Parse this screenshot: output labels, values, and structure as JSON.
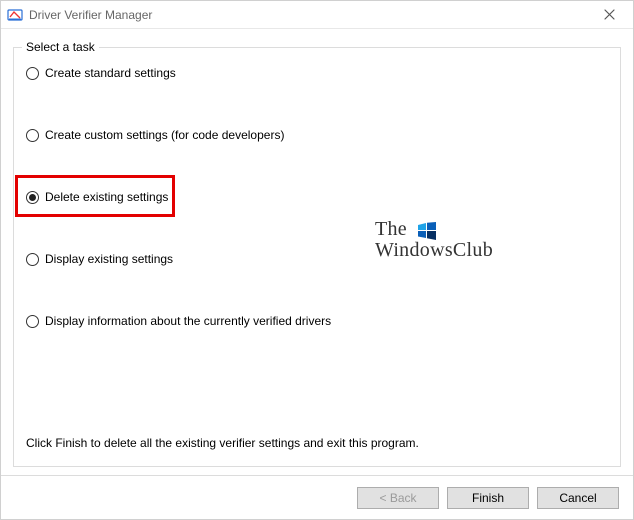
{
  "window": {
    "title": "Driver Verifier Manager"
  },
  "group": {
    "title": "Select a task"
  },
  "options": [
    {
      "label": "Create standard settings",
      "selected": false
    },
    {
      "label": "Create custom settings (for code developers)",
      "selected": false
    },
    {
      "label": "Delete existing settings",
      "selected": true,
      "highlighted": true
    },
    {
      "label": "Display existing settings",
      "selected": false
    },
    {
      "label": "Display information about the currently verified drivers",
      "selected": false
    }
  ],
  "info_text": "Click Finish to delete all the existing verifier settings and exit this program.",
  "footer": {
    "back": "< Back",
    "back_enabled": false,
    "finish": "Finish",
    "cancel": "Cancel"
  },
  "watermark": {
    "line1": "The",
    "line2": "WindowsClub"
  },
  "colors": {
    "highlight_border": "#e30000"
  }
}
